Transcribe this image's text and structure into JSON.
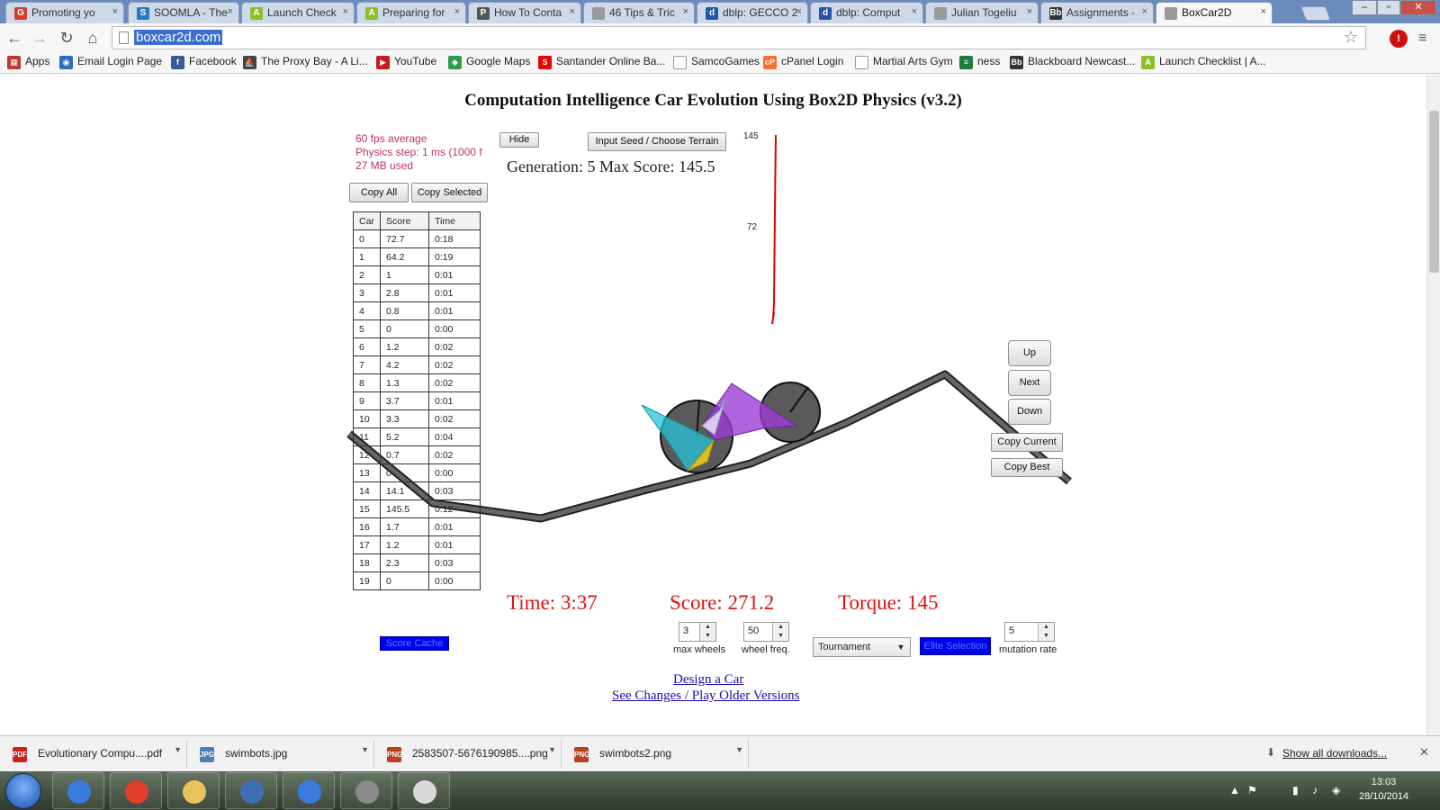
{
  "browser": {
    "tabs": [
      {
        "label": "Promoting yo",
        "fav": "G",
        "color": "#d23f31"
      },
      {
        "label": "SOOMLA - The",
        "fav": "S",
        "color": "#2b79c2"
      },
      {
        "label": "Launch Check",
        "fav": "A",
        "color": "#8cbf26"
      },
      {
        "label": "Preparing for",
        "fav": "A",
        "color": "#8cbf26"
      },
      {
        "label": "How To Conta",
        "fav": "P",
        "color": "#555555"
      },
      {
        "label": "46 Tips & Tric",
        "fav": "",
        "color": "#999999"
      },
      {
        "label": "dblp: GECCO 2",
        "fav": "d",
        "color": "#2255aa"
      },
      {
        "label": "dblp: Comput",
        "fav": "d",
        "color": "#2255aa"
      },
      {
        "label": "Julian Togeliu",
        "fav": "",
        "color": "#999999"
      },
      {
        "label": "Assignments -",
        "fav": "Bb",
        "color": "#333333"
      },
      {
        "label": "BoxCar2D",
        "fav": "",
        "color": "#999999"
      }
    ],
    "url": "boxcar2d.com",
    "window_controls": [
      "–",
      "▫",
      "✕"
    ]
  },
  "bookmarks": [
    {
      "label": "Apps",
      "fav": "▦",
      "color": "#c0392b"
    },
    {
      "label": "Email Login Page",
      "fav": "◉",
      "color": "#2d6fb5"
    },
    {
      "label": "Facebook",
      "fav": "f",
      "color": "#3b5998"
    },
    {
      "label": "The Proxy Bay - A Li...",
      "fav": "⛵",
      "color": "#444444"
    },
    {
      "label": "YouTube",
      "fav": "▶",
      "color": "#cc181e"
    },
    {
      "label": "Google Maps",
      "fav": "◆",
      "color": "#2a9d4a"
    },
    {
      "label": "Santander Online Ba...",
      "fav": "S",
      "color": "#ec0000"
    },
    {
      "label": "SamcoGames",
      "fav": "",
      "color": "#999999"
    },
    {
      "label": "cPanel Login",
      "fav": "cP",
      "color": "#ff6c2c"
    },
    {
      "label": "Martial Arts Gym",
      "fav": "",
      "color": "#999999"
    },
    {
      "label": "ness",
      "fav": "≡",
      "color": "#1c7c3c"
    },
    {
      "label": "Blackboard Newcast...",
      "fav": "Bb",
      "color": "#333333"
    },
    {
      "label": "Launch Checklist | A...",
      "fav": "A",
      "color": "#8cbf26"
    }
  ],
  "page": {
    "title": "Computation Intelligence Car Evolution Using Box2D Physics (v3.2)",
    "stats": [
      "60 fps average",
      "Physics step: 1 ms (1000 f",
      "27 MB used"
    ],
    "hide_label": "Hide",
    "seed_label": "Input Seed / Choose Terrain",
    "generation_text": "Generation: 5  Max Score: 145.5",
    "copy_all_label": "Copy All",
    "copy_selected_label": "Copy Selected",
    "table_headers": [
      "Car",
      "Score",
      "Time"
    ],
    "table_rows": [
      [
        "0",
        "72.7",
        "0:18"
      ],
      [
        "1",
        "64.2",
        "0:19"
      ],
      [
        "2",
        "1",
        "0:01"
      ],
      [
        "3",
        "2.8",
        "0:01"
      ],
      [
        "4",
        "0.8",
        "0:01"
      ],
      [
        "5",
        "0",
        "0:00"
      ],
      [
        "6",
        "1.2",
        "0:02"
      ],
      [
        "7",
        "4.2",
        "0:02"
      ],
      [
        "8",
        "1.3",
        "0:02"
      ],
      [
        "9",
        "3.7",
        "0:01"
      ],
      [
        "10",
        "3.3",
        "0:02"
      ],
      [
        "11",
        "5.2",
        "0:04"
      ],
      [
        "12",
        "0.7",
        "0:02"
      ],
      [
        "13",
        "0",
        "0:00"
      ],
      [
        "14",
        "14.1",
        "0:03"
      ],
      [
        "15",
        "145.5",
        "0:12"
      ],
      [
        "16",
        "1.7",
        "0:01"
      ],
      [
        "17",
        "1.2",
        "0:01"
      ],
      [
        "18",
        "2.3",
        "0:03"
      ],
      [
        "19",
        "0",
        "0:00"
      ]
    ],
    "graph_labels": [
      "145",
      "72"
    ],
    "view_buttons": [
      "Up",
      "Next",
      "Down"
    ],
    "copy_current_label": "Copy Current",
    "copy_best_label": "Copy Best",
    "time_text": "Time: 3:37",
    "score_text": "Score: 271.2",
    "torque_text": "Torque: 145",
    "score_cache_label": "Score Cache",
    "max_wheels": {
      "value": "3",
      "caption": "max wheels"
    },
    "wheel_freq": {
      "value": "50",
      "caption": "wheel freq."
    },
    "selection_method": "Tournament",
    "elite_selection_label": "Elite Selection",
    "mutation_rate": {
      "value": "5",
      "caption": "mutation rate"
    },
    "design_link": "Design a Car",
    "changes_link": "See Changes / Play Older Versions"
  },
  "downloads": {
    "items": [
      {
        "name": "Evolutionary Compu....pdf",
        "type": "PDF",
        "color": "#c8221c"
      },
      {
        "name": "swimbots.jpg",
        "type": "JPG",
        "color": "#4a7fb5"
      },
      {
        "name": "2583507-5676190985....png",
        "type": "PNG",
        "color": "#b8401a"
      },
      {
        "name": "swimbots2.png",
        "type": "PNG",
        "color": "#b8401a"
      }
    ],
    "show_all": "Show all downloads..."
  },
  "taskbar": {
    "apps": [
      "itunes-icon",
      "chrome-icon",
      "explorer-icon",
      "paint-icon",
      "itunes2-icon",
      "gimp-icon",
      "paint-palette-icon"
    ],
    "time": "13:03",
    "date": "28/10/2014"
  },
  "colors": {
    "accent_red": "#e41010",
    "stats_pink": "#c0306a",
    "blue_button": "#0000ee",
    "graph_line": "#dd0000"
  }
}
